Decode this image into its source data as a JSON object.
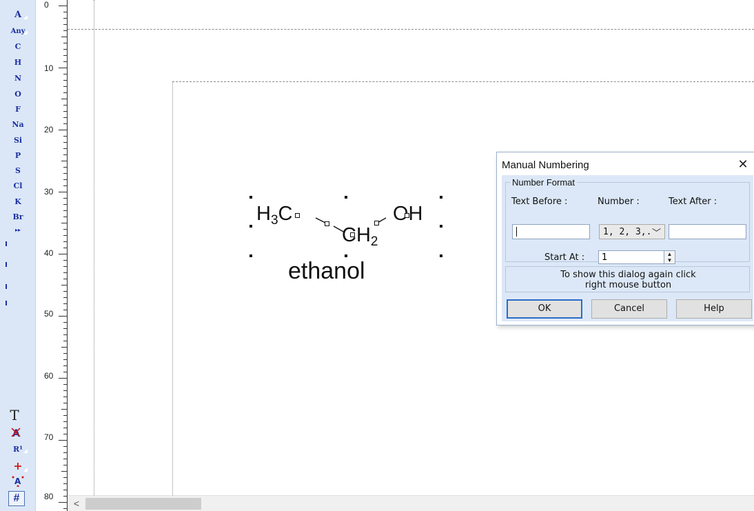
{
  "toolbar": {
    "atoms": [
      "A",
      "Any",
      "C",
      "H",
      "N",
      "O",
      "F",
      "Na",
      "Si",
      "P",
      "S",
      "Cl",
      "K",
      "Br"
    ],
    "text_tool": "T",
    "r_group": "R¹",
    "plus": "+",
    "numbering": "#"
  },
  "ruler": {
    "labels": [
      "0",
      "10",
      "20",
      "30",
      "40",
      "50",
      "60",
      "70",
      "80"
    ]
  },
  "molecule": {
    "h3c": "H",
    "h3c_sub": "3",
    "h3c_c": "C",
    "ch2_c": "CH",
    "ch2_sub": "2",
    "oh": "OH",
    "name": "ethanol"
  },
  "dialog": {
    "title": "Manual Numbering",
    "close": "✕",
    "group_title": "Number Format",
    "text_before_label": "Text Before :",
    "text_before_value": "",
    "number_label": "Number :",
    "number_value": "1, 2, 3,.",
    "text_after_label": "Text After :",
    "text_after_value": "",
    "start_at_label": "Start At :",
    "start_at_value": "1",
    "info_line1": "To show this dialog again click",
    "info_line2": "right mouse button",
    "ok": "OK",
    "cancel": "Cancel",
    "help": "Help"
  },
  "scrollbar": {
    "left_arrow": "<"
  }
}
